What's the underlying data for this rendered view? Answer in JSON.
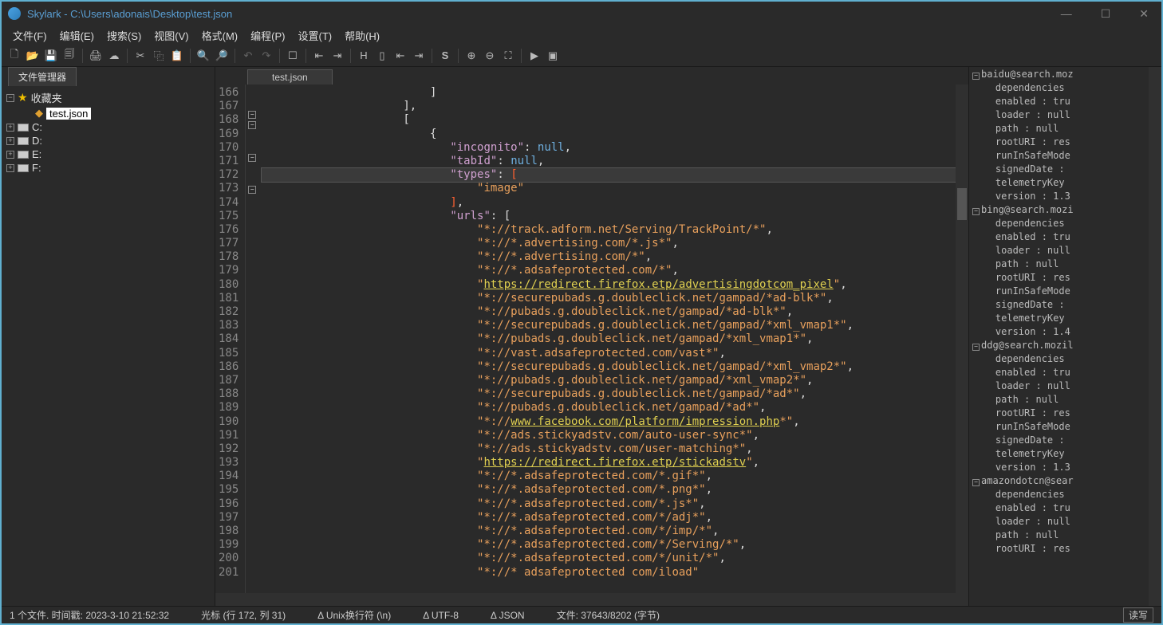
{
  "title": "Skylark - C:\\Users\\adonais\\Desktop\\test.json",
  "menus": [
    "文件(F)",
    "编辑(E)",
    "搜索(S)",
    "视图(V)",
    "格式(M)",
    "编程(P)",
    "设置(T)",
    "帮助(H)"
  ],
  "sidebar": {
    "tab": "文件管理器",
    "fav": "收藏夹",
    "file": "test.json",
    "drives": [
      "C:",
      "D:",
      "E:",
      "F:"
    ]
  },
  "tab": "test.json",
  "lines_start": 166,
  "lines_end": 201,
  "code_rows": [
    {
      "indent": 28,
      "html": "<span class='br'>]</span>"
    },
    {
      "indent": 24,
      "html": "<span class='br'>],</span>"
    },
    {
      "indent": 24,
      "html": "<span class='br'>[</span>",
      "fold": "-"
    },
    {
      "indent": 28,
      "html": "<span class='br'>{</span>",
      "fold": "-"
    },
    {
      "indent": 32,
      "html": "<span class='k'>\"incognito\"</span>: <span class='n'>null</span>,"
    },
    {
      "indent": 32,
      "html": "<span class='k'>\"tabId\"</span>: <span class='n'>null</span>,"
    },
    {
      "indent": 32,
      "html": "<span class='k'>\"types\"</span>: <span class='cursor'>[</span>",
      "fold": "-",
      "current": true
    },
    {
      "indent": 36,
      "html": "<span class='s'>\"image\"</span>"
    },
    {
      "indent": 32,
      "html": "<span class='cursor'>]</span>,"
    },
    {
      "indent": 32,
      "html": "<span class='k'>\"urls\"</span>: <span class='br'>[</span>",
      "fold": "-"
    },
    {
      "indent": 36,
      "html": "<span class='s'>\"*://track.adform.net/Serving/TrackPoint/*\"</span>,"
    },
    {
      "indent": 36,
      "html": "<span class='s'>\"*://*.advertising.com/*.js*\"</span>,"
    },
    {
      "indent": 36,
      "html": "<span class='s'>\"*://*.advertising.com/*\"</span>,"
    },
    {
      "indent": 36,
      "html": "<span class='s'>\"*://*.adsafeprotected.com/*\"</span>,"
    },
    {
      "indent": 36,
      "html": "<span class='s'>\"</span><span class='u'>https://redirect.firefox.etp/advertisingdotcom_pixel</span><span class='s'>\"</span>,"
    },
    {
      "indent": 36,
      "html": "<span class='s'>\"*://securepubads.g.doubleclick.net/gampad/*ad-blk*\"</span>,"
    },
    {
      "indent": 36,
      "html": "<span class='s'>\"*://pubads.g.doubleclick.net/gampad/*ad-blk*\"</span>,"
    },
    {
      "indent": 36,
      "html": "<span class='s'>\"*://securepubads.g.doubleclick.net/gampad/*xml_vmap1*\"</span>,"
    },
    {
      "indent": 36,
      "html": "<span class='s'>\"*://pubads.g.doubleclick.net/gampad/*xml_vmap1*\"</span>,"
    },
    {
      "indent": 36,
      "html": "<span class='s'>\"*://vast.adsafeprotected.com/vast*\"</span>,"
    },
    {
      "indent": 36,
      "html": "<span class='s'>\"*://securepubads.g.doubleclick.net/gampad/*xml_vmap2*\"</span>,"
    },
    {
      "indent": 36,
      "html": "<span class='s'>\"*://pubads.g.doubleclick.net/gampad/*xml_vmap2*\"</span>,"
    },
    {
      "indent": 36,
      "html": "<span class='s'>\"*://securepubads.g.doubleclick.net/gampad/*ad*\"</span>,"
    },
    {
      "indent": 36,
      "html": "<span class='s'>\"*://pubads.g.doubleclick.net/gampad/*ad*\"</span>,"
    },
    {
      "indent": 36,
      "html": "<span class='s'>\"*://</span><span class='u'>www.facebook.com/platform/impression.php</span><span class='s'>*\"</span>,"
    },
    {
      "indent": 36,
      "html": "<span class='s'>\"*://ads.stickyadstv.com/auto-user-sync*\"</span>,"
    },
    {
      "indent": 36,
      "html": "<span class='s'>\"*://ads.stickyadstv.com/user-matching*\"</span>,"
    },
    {
      "indent": 36,
      "html": "<span class='s'>\"</span><span class='u'>https://redirect.firefox.etp/stickadstv</span><span class='s'>\"</span>,"
    },
    {
      "indent": 36,
      "html": "<span class='s'>\"*://*.adsafeprotected.com/*.gif*\"</span>,"
    },
    {
      "indent": 36,
      "html": "<span class='s'>\"*://*.adsafeprotected.com/*.png*\"</span>,"
    },
    {
      "indent": 36,
      "html": "<span class='s'>\"*://*.adsafeprotected.com/*.js*\"</span>,"
    },
    {
      "indent": 36,
      "html": "<span class='s'>\"*://*.adsafeprotected.com/*/adj*\"</span>,"
    },
    {
      "indent": 36,
      "html": "<span class='s'>\"*://*.adsafeprotected.com/*/imp/*\"</span>,"
    },
    {
      "indent": 36,
      "html": "<span class='s'>\"*://*.adsafeprotected.com/*/Serving/*\"</span>,"
    },
    {
      "indent": 36,
      "html": "<span class='s'>\"*://*.adsafeprotected.com/*/unit/*\"</span>,"
    },
    {
      "indent": 36,
      "html": "<span class='s'>\"*://* adsafeprotected com/iload\"</span>"
    }
  ],
  "outline": [
    {
      "type": "head",
      "text": "baidu@search.moz"
    },
    {
      "type": "item",
      "text": "dependencies"
    },
    {
      "type": "item",
      "text": "enabled : tru"
    },
    {
      "type": "item",
      "text": "loader : null"
    },
    {
      "type": "item",
      "text": "path : null"
    },
    {
      "type": "item",
      "text": "rootURI : res"
    },
    {
      "type": "item",
      "text": "runInSafeMode"
    },
    {
      "type": "item",
      "text": "signedDate : "
    },
    {
      "type": "item",
      "text": "telemetryKey"
    },
    {
      "type": "item",
      "text": "version : 1.3"
    },
    {
      "type": "head",
      "text": "bing@search.mozi"
    },
    {
      "type": "item",
      "text": "dependencies"
    },
    {
      "type": "item",
      "text": "enabled : tru"
    },
    {
      "type": "item",
      "text": "loader : null"
    },
    {
      "type": "item",
      "text": "path : null"
    },
    {
      "type": "item",
      "text": "rootURI : res"
    },
    {
      "type": "item",
      "text": "runInSafeMode"
    },
    {
      "type": "item",
      "text": "signedDate : "
    },
    {
      "type": "item",
      "text": "telemetryKey"
    },
    {
      "type": "item",
      "text": "version : 1.4"
    },
    {
      "type": "head",
      "text": "ddg@search.mozil"
    },
    {
      "type": "item",
      "text": "dependencies"
    },
    {
      "type": "item",
      "text": "enabled : tru"
    },
    {
      "type": "item",
      "text": "loader : null"
    },
    {
      "type": "item",
      "text": "path : null"
    },
    {
      "type": "item",
      "text": "rootURI : res"
    },
    {
      "type": "item",
      "text": "runInSafeMode"
    },
    {
      "type": "item",
      "text": "signedDate : "
    },
    {
      "type": "item",
      "text": "telemetryKey"
    },
    {
      "type": "item",
      "text": "version : 1.3"
    },
    {
      "type": "head",
      "text": "amazondotcn@sear"
    },
    {
      "type": "item",
      "text": "dependencies"
    },
    {
      "type": "item",
      "text": "enabled : tru"
    },
    {
      "type": "item",
      "text": "loader : null"
    },
    {
      "type": "item",
      "text": "path : null"
    },
    {
      "type": "item",
      "text": "rootURI : res"
    }
  ],
  "status": {
    "left": "1 个文件.  时间戳: 2023-3-10 21:52:32",
    "cursor": "光标 (行 172, 列 31)",
    "eol": "Δ Unix换行符 (\\n)",
    "enc": "Δ UTF-8",
    "lang": "Δ JSON",
    "size": "文件: 37643/8202 (字节)",
    "rw": "读写"
  }
}
